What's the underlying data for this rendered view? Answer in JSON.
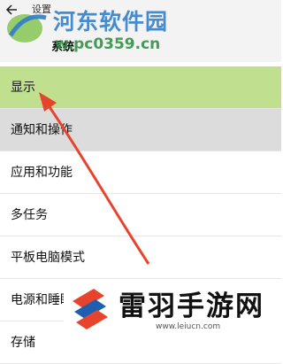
{
  "header": {
    "app_title": "设置",
    "section_title": "系统"
  },
  "watermark_top": {
    "title": "河东软件园",
    "url": "w.pc0359.cn"
  },
  "menu": {
    "items": [
      {
        "label": "显示"
      },
      {
        "label": "通知和操作"
      },
      {
        "label": "应用和功能"
      },
      {
        "label": "多任务"
      },
      {
        "label": "平板电脑模式"
      },
      {
        "label": "电源和睡眠"
      },
      {
        "label": "存储"
      }
    ]
  },
  "watermark_bottom": {
    "title": "雷羽手游网",
    "url": "www.leiucn.com"
  },
  "colors": {
    "selected_bg": "#c0df8f",
    "hover_bg": "#dcdcdc",
    "arrow": "#e8432c"
  }
}
